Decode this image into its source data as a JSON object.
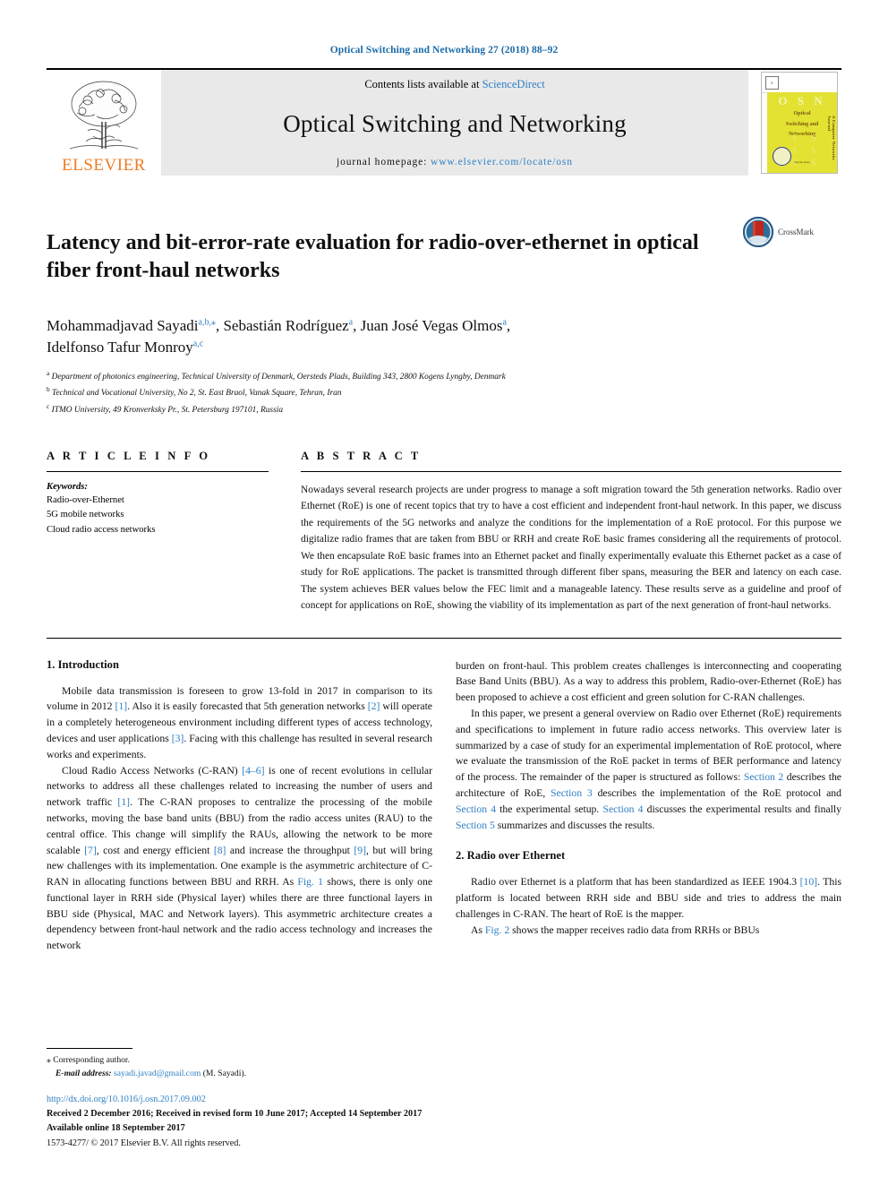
{
  "running_head": "Optical Switching and Networking 27 (2018) 88–92",
  "masthead": {
    "publisher_logo_text": "ELSEVIER",
    "contents_prefix": "Contents lists available at ",
    "contents_link": "ScienceDirect",
    "journal_title": "Optical Switching and Networking",
    "homepage_prefix": "journal homepage: ",
    "homepage_url": "www.elsevier.com/locate/osn",
    "cover": {
      "acronym": "O S N",
      "title_lines": [
        "Optical",
        "Switching and",
        "Networking"
      ],
      "spine_text": "A Computer Networks Journal",
      "special_issue_label": "Special Issue",
      "special_issue_text": "Guest Editors",
      "editor_text": "Advanced Mechanisms, tools, Optics, Wireless Technologies, access resources and recovery speed"
    }
  },
  "article": {
    "title": "Latency and bit-error-rate evaluation for radio-over-ethernet in optical fiber front-haul networks",
    "crossmark_label": "CrossMark",
    "authors": [
      {
        "name": "Mohammadjavad Sayadi",
        "sup": "a,b,",
        "star": "⁎",
        "sep": ", "
      },
      {
        "name": "Sebastián Rodríguez",
        "sup": "a",
        "star": "",
        "sep": ", "
      },
      {
        "name": "Juan José Vegas Olmos",
        "sup": "a",
        "star": "",
        "sep": ","
      },
      {
        "name": "Idelfonso Tafur Monroy",
        "sup": "a,c",
        "star": "",
        "sep": ""
      }
    ],
    "affiliations": [
      {
        "marker": "a",
        "text": "Department of photonics engineering, Technical University of Denmark, Oersteds Plads, Building 343, 2800 Kogens Lyngby, Denmark"
      },
      {
        "marker": "b",
        "text": "Technical and Vocational University, No 2, St. East Braol, Vanak Square, Tehran, Iran"
      },
      {
        "marker": "c",
        "text": "ITMO University, 49 Kronverksky Pr., St. Petersburg 197101, Russia"
      }
    ]
  },
  "article_info": {
    "heading": "A R T I C L E  I N F O",
    "keywords_label": "Keywords:",
    "keywords": [
      "Radio-over-Ethernet",
      "5G mobile networks",
      "Cloud radio access networks"
    ]
  },
  "abstract": {
    "heading": "A B S T R A C T",
    "text": "Nowadays several research projects are under progress to manage a soft migration toward the 5th generation networks. Radio over Ethernet (RoE) is one of recent topics that try to have a cost efficient and independent front-haul network. In this paper, we discuss the requirements of the 5G networks and analyze the conditions for the implementation of a RoE protocol. For this purpose we digitalize radio frames that are taken from BBU or RRH and create RoE basic frames considering all the requirements of protocol. We then encapsulate RoE basic frames into an Ethernet packet and finally experimentally evaluate this Ethernet packet as a case of study for RoE applications. The packet is transmitted through different fiber spans, measuring the BER and latency on each case. The system achieves BER values below the FEC limit and a manageable latency. These results serve as a guideline and proof of concept for applications on RoE, showing the viability of its implementation as part of the next generation of front-haul networks."
  },
  "sections": {
    "intro_heading": "1.  Introduction",
    "intro_p1_a": "Mobile data transmission is foreseen to grow 13-fold in 2017 in comparison to its volume in 2012 ",
    "intro_p1_r1": "[1]",
    "intro_p1_b": ". Also it is easily forecasted that 5th generation networks ",
    "intro_p1_r2": "[2]",
    "intro_p1_c": " will operate in a completely heterogeneous environment including different types of access technology, devices and user applications ",
    "intro_p1_r3": "[3]",
    "intro_p1_d": ". Facing with this challenge has resulted in several research works and experiments.",
    "intro_p2_a": "Cloud Radio Access Networks (C-RAN) ",
    "intro_p2_r1": "[4–6]",
    "intro_p2_b": " is one of recent evolutions in cellular networks to address all these challenges related to increasing the number of users and network traffic ",
    "intro_p2_r2": "[1]",
    "intro_p2_c": ". The C-RAN proposes to centralize the processing of the mobile networks, moving the base band units (BBU) from the radio access unites (RAU) to the central office. This change will simplify the RAUs, allowing the network to be more scalable ",
    "intro_p2_r3": "[7]",
    "intro_p2_d": ", cost and energy efficient ",
    "intro_p2_r4": "[8]",
    "intro_p2_e": " and increase the throughput ",
    "intro_p2_r5": "[9]",
    "intro_p2_f": ", but will bring new challenges with its implementation. One example is the asymmetric architecture of C-RAN in allocating functions between BBU and RRH. As ",
    "intro_p2_r6": "Fig. 1",
    "intro_p2_g": " shows, there is only one functional layer in RRH side (Physical layer) whiles there are three functional layers in BBU side (Physical, MAC and Network layers). This asymmetric architecture creates a dependency between front-haul network and the radio access technology and increases the network",
    "right_p1": "burden on front-haul. This problem creates challenges is interconnecting and cooperating Base Band Units (BBU). As a way to address this problem, Radio-over-Ethernet (RoE) has been proposed to achieve a cost efficient and green solution for C-RAN challenges.",
    "right_p2_a": "In this paper, we present a general overview on Radio over Ethernet (RoE) requirements and specifications to implement in future radio access networks. This overview later is summarized by a case of study for an experimental implementation of RoE protocol, where we evaluate the transmission of the RoE packet in terms of BER performance and latency of the process. The remainder of the paper is structured as follows: ",
    "right_p2_r1": "Section 2",
    "right_p2_b": " describes the architecture of RoE, ",
    "right_p2_r2": "Section 3",
    "right_p2_c": " describes the implementation of the RoE protocol and ",
    "right_p2_r3": "Section 4",
    "right_p2_d": " the experimental setup. ",
    "right_p2_r4": "Section 4",
    "right_p2_e": " discusses the experimental results and finally ",
    "right_p2_r5": "Section 5",
    "right_p2_f": " summarizes and discusses the results.",
    "roe_heading": "2.  Radio over Ethernet",
    "roe_p1_a": "Radio over Ethernet is a platform that has been standardized as IEEE 1904.3 ",
    "roe_p1_r1": "[10]",
    "roe_p1_b": ". This platform is located between RRH side and BBU side and tries to address the main challenges in C-RAN. The heart of RoE is the mapper.",
    "roe_p2_a": "As ",
    "roe_p2_r1": "Fig. 2",
    "roe_p2_b": " shows the mapper receives radio data from RRHs or BBUs"
  },
  "footer": {
    "corresponding_marker": "⁎",
    "corresponding_text": " Corresponding author.",
    "email_label": "E-mail address:",
    "email": "sayadi.javad@gmail.com",
    "email_suffix": " (M. Sayadi).",
    "doi": "http://dx.doi.org/10.1016/j.osn.2017.09.002",
    "received": "Received 2 December 2016; Received in revised form 10 June 2017; Accepted 14 September 2017",
    "available": "Available online 18 September 2017",
    "copyright": "1573-4277/ © 2017 Elsevier B.V. All rights reserved."
  },
  "colors": {
    "link": "#2f7fc4",
    "running_head": "#1a6ba8",
    "elsevier_orange": "#ef7c22",
    "cover_yellow": "#e3e233"
  }
}
